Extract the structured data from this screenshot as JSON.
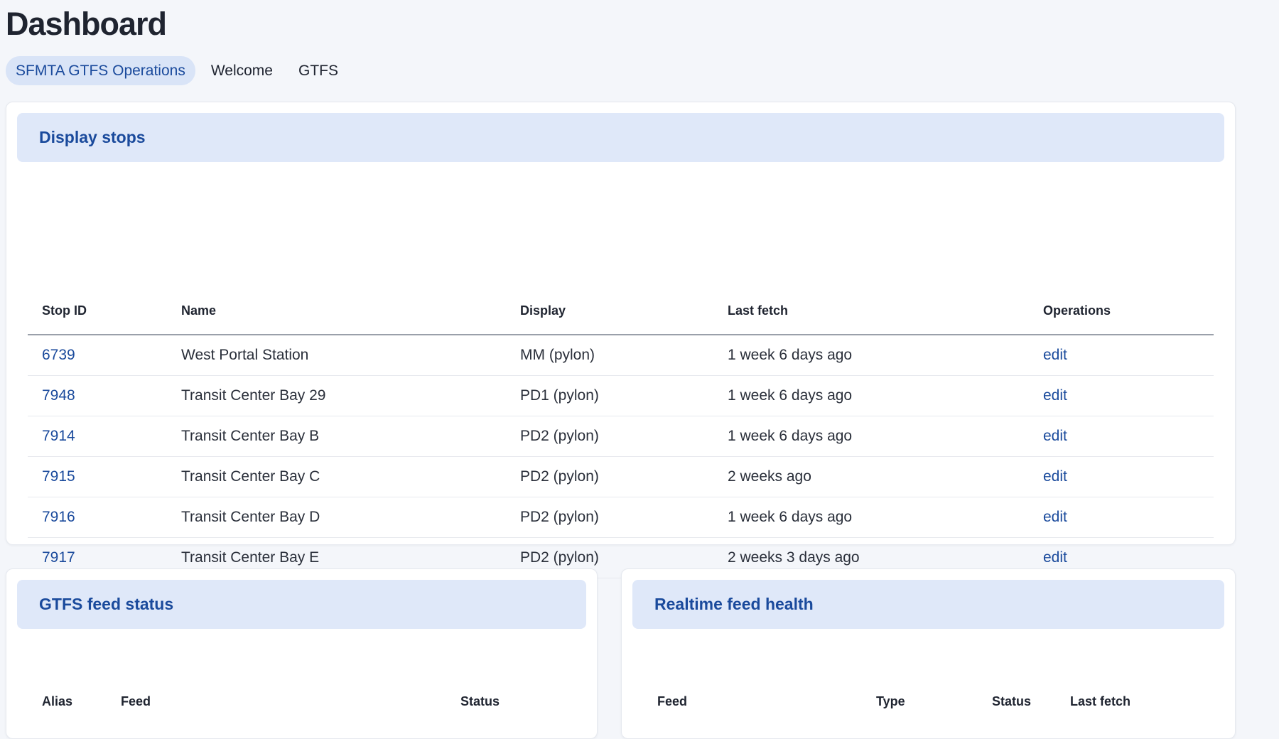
{
  "page": {
    "title": "Dashboard"
  },
  "tabs": [
    {
      "label": "SFMTA GTFS Operations",
      "active": true
    },
    {
      "label": "Welcome",
      "active": false
    },
    {
      "label": "GTFS",
      "active": false
    }
  ],
  "display_stops": {
    "title": "Display stops",
    "columns": [
      "Stop ID",
      "Name",
      "Display",
      "Last fetch",
      "Operations"
    ],
    "rows": [
      {
        "stop_id": "6739",
        "name": "West Portal Station",
        "display": "MM (pylon)",
        "last_fetch": "1 week 6 days ago",
        "operation": "edit"
      },
      {
        "stop_id": "7948",
        "name": "Transit Center Bay 29",
        "display": "PD1 (pylon)",
        "last_fetch": "1 week 6 days ago",
        "operation": "edit"
      },
      {
        "stop_id": "7914",
        "name": "Transit Center Bay B",
        "display": "PD2 (pylon)",
        "last_fetch": "1 week 6 days ago",
        "operation": "edit"
      },
      {
        "stop_id": "7915",
        "name": "Transit Center Bay C",
        "display": "PD2 (pylon)",
        "last_fetch": "2 weeks ago",
        "operation": "edit"
      },
      {
        "stop_id": "7916",
        "name": "Transit Center Bay D",
        "display": "PD2 (pylon)",
        "last_fetch": "1 week 6 days ago",
        "operation": "edit"
      },
      {
        "stop_id": "7917",
        "name": "Transit Center Bay E",
        "display": "PD2 (pylon)",
        "last_fetch": "2 weeks 3 days ago",
        "operation": "edit"
      }
    ]
  },
  "gtfs_feed_status": {
    "title": "GTFS feed status",
    "columns": [
      "Alias",
      "Feed",
      "Status"
    ]
  },
  "realtime_feed_health": {
    "title": "Realtime feed health",
    "columns": [
      "Feed",
      "Type",
      "Status",
      "Last fetch"
    ]
  },
  "colors": {
    "accent": "#1a4a9c",
    "header_bg": "#dfe8f9",
    "page_bg": "#f4f6fa"
  }
}
